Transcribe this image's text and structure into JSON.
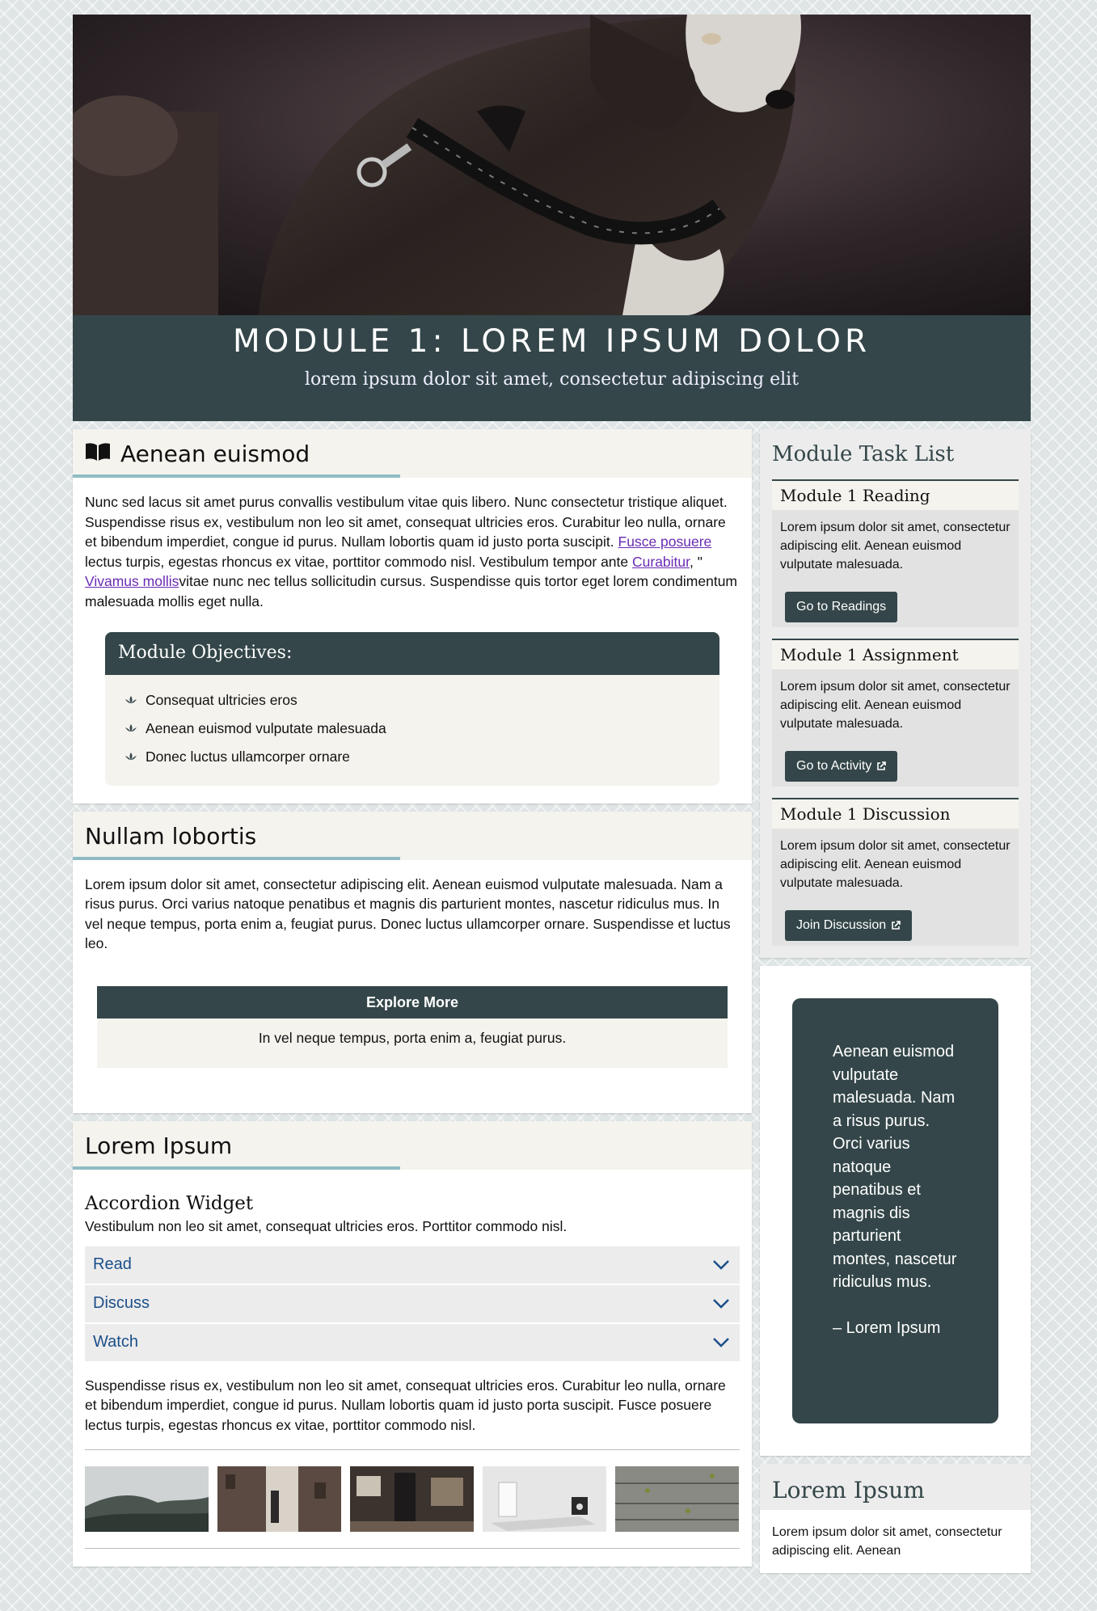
{
  "hero": {
    "title": "MODULE 1: LOREM IPSUM DOLOR",
    "subtitle": "lorem ipsum dolor sit amet, consectetur adipiscing elit"
  },
  "section1": {
    "heading": "Aenean euismod",
    "icon": "book-open-icon",
    "paragraph": {
      "part1": "Nunc sed lacus sit amet purus convallis vestibulum vitae quis libero. Nunc consectetur tristique aliquet. Suspendisse risus ex, vestibulum non leo sit amet, consequat ultricies eros. Curabitur leo nulla, ornare et bibendum imperdiet, congue id purus. Nullam lobortis quam id justo porta suscipit. ",
      "link1": "Fusce posuere",
      "part2": " lectus turpis, egestas rhoncus ex vitae, porttitor commodo nisl. Vestibulum tempor ante ",
      "link2": "Curabitur",
      "part3": ", \" ",
      "link3": "Vivamus mollis",
      "part4": "vitae nunc nec tellus sollicitudin cursus. Suspendisse quis tortor eget lorem condimentum malesuada mollis eget nulla."
    },
    "objectives": {
      "title": "Module Objectives:",
      "items": [
        "Consequat ultricies eros",
        "Aenean euismod vulputate malesuada",
        "Donec luctus ullamcorper ornare"
      ]
    }
  },
  "section2": {
    "heading": "Nullam lobortis",
    "paragraph": "Lorem ipsum dolor sit amet, consectetur adipiscing elit. Aenean euismod vulputate malesuada. Nam a risus purus. Orci varius natoque penatibus et magnis dis parturient montes, nascetur ridiculus mus. In vel neque tempus, porta enim a, feugiat purus. Donec luctus ullamcorper ornare. Suspendisse et luctus leo.",
    "explore": {
      "title": "Explore More",
      "text": "In vel neque tempus, porta enim a, feugiat purus."
    }
  },
  "section3": {
    "heading": "Lorem Ipsum",
    "accordion_title": "Accordion Widget",
    "accordion_desc": "Vestibulum non leo sit amet, consequat ultricies eros. Porttitor commodo nisl.",
    "accordion_items": [
      "Read",
      "Discuss",
      "Watch"
    ],
    "after_text": "Suspendisse risus ex, vestibulum non leo sit amet, consequat ultricies eros. Curabitur leo nulla, ornare et bibendum imperdiet, congue id purus. Nullam lobortis quam id justo porta suscipit. Fusce posuere lectus turpis, egestas rhoncus ex vitae, porttitor commodo nisl."
  },
  "sidebar": {
    "task_list_title": "Module Task List",
    "tasks": [
      {
        "title": "Module 1 Reading",
        "text": "Lorem ipsum dolor sit amet, consectetur adipiscing elit. Aenean euismod vulputate malesuada.",
        "button": "Go to Readings"
      },
      {
        "title": "Module 1 Assignment",
        "text": "Lorem ipsum dolor sit amet, consectetur adipiscing elit. Aenean euismod vulputate malesuada.",
        "button": "Go to Activity"
      },
      {
        "title": "Module 1 Discussion",
        "text": "Lorem ipsum dolor sit amet, consectetur adipiscing elit. Aenean euismod vulputate malesuada.",
        "button": "Join Discussion"
      }
    ],
    "quote": {
      "text": "Aenean euismod vulputate malesuada. Nam a risus purus. Orci varius natoque penatibus et magnis dis parturient montes, nascetur ridiculus mus.",
      "attribution": "– Lorem Ipsum"
    },
    "footer_card": {
      "title": "Lorem Ipsum",
      "text": "Lorem ipsum dolor sit amet, consectetur adipiscing elit. Aenean"
    }
  },
  "colors": {
    "dark_teal": "#344649",
    "accent_underline": "#8fbcc4",
    "cream": "#f5f3ee",
    "link_purple": "#6a2bb3",
    "accordion_blue": "#1b4f8a"
  }
}
